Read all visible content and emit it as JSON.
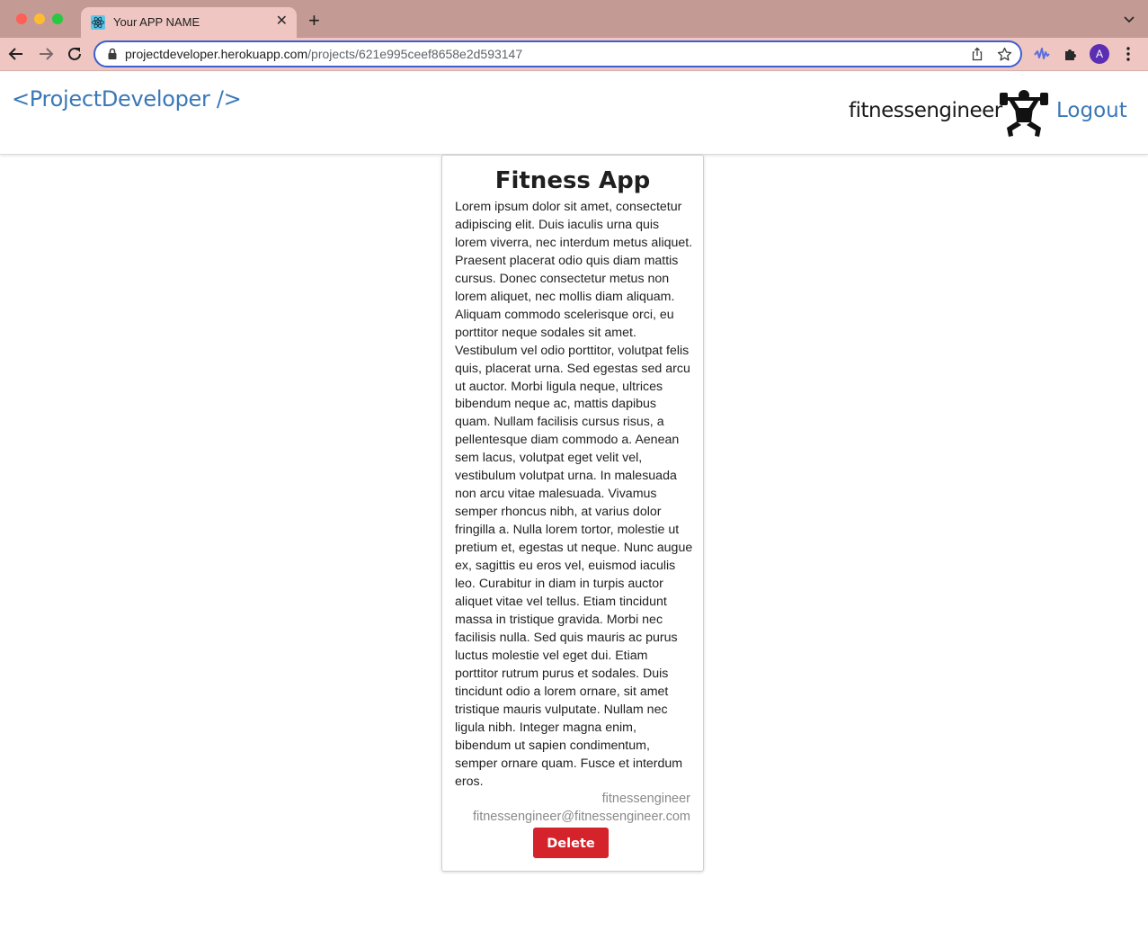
{
  "browser": {
    "tab_title": "Your APP NAME",
    "url_host": "projectdeveloper.herokuapp.com",
    "url_path": "/projects/621e995ceef8658e2d593147",
    "profile_initial": "A"
  },
  "navbar": {
    "brand": "<ProjectDeveloper />",
    "username": "fitnessengineer",
    "logout_label": "Logout",
    "avatar_icon": "weightlifter-icon"
  },
  "project": {
    "title": "Fitness App",
    "description": "Lorem ipsum dolor sit amet, consectetur adipiscing elit. Duis iaculis urna quis lorem viverra, nec interdum metus aliquet. Praesent placerat odio quis diam mattis cursus. Donec consectetur metus non lorem aliquet, nec mollis diam aliquam. Aliquam commodo scelerisque orci, eu porttitor neque sodales sit amet. Vestibulum vel odio porttitor, volutpat felis quis, placerat urna. Sed egestas sed arcu ut auctor. Morbi ligula neque, ultrices bibendum neque ac, mattis dapibus quam. Nullam facilisis cursus risus, a pellentesque diam commodo a. Aenean sem lacus, volutpat eget velit vel, vestibulum volutpat urna. In malesuada non arcu vitae malesuada. Vivamus semper rhoncus nibh, at varius dolor fringilla a. Nulla lorem tortor, molestie ut pretium et, egestas ut neque. Nunc augue ex, sagittis eu eros vel, euismod iaculis leo. Curabitur in diam in turpis auctor aliquet vitae vel tellus. Etiam tincidunt massa in tristique gravida. Morbi nec facilisis nulla. Sed quis mauris ac purus luctus molestie vel eget dui. Etiam porttitor rutrum purus et sodales. Duis tincidunt odio a lorem ornare, sit amet tristique mauris vulputate. Nullam nec ligula nibh. Integer magna enim, bibendum ut sapien condimentum, semper ornare quam. Fusce et interdum eros.",
    "author": "fitnessengineer",
    "email": "fitnessengineer@fitnessengineer.com",
    "delete_label": "Delete"
  },
  "colors": {
    "brand_blue": "#3a78b8",
    "delete_red": "#d4232a",
    "tabbar": "#c49a94",
    "toolbar": "#efc6c1"
  }
}
